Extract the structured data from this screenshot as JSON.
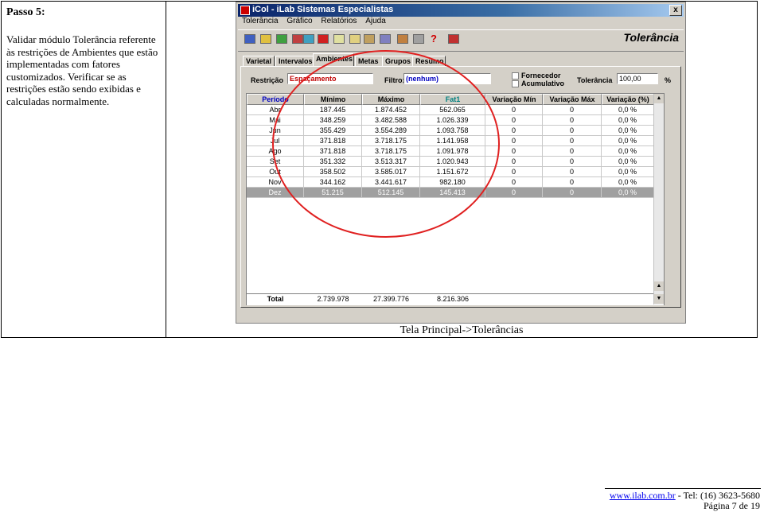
{
  "doc": {
    "step_title": "Passo 5:",
    "description": "Validar módulo Tolerância referente às restrições de Ambientes que estão implementadas com fatores customizados. Verificar se as restrições estão sendo exibidas e calculadas normalmente.",
    "caption": "Tela Principal->Tolerâncias"
  },
  "window": {
    "title": "iCol - iLab Sistemas Especialistas",
    "close": "x",
    "menu": [
      "Tolerância",
      "Gráfico",
      "Relatórios",
      "Ajuda"
    ],
    "header": "Tolerância",
    "tabs": [
      "Varietal",
      "Intervalos",
      "Ambientes",
      "Metas",
      "Grupos",
      "Resumo"
    ],
    "active_tab": "Ambientes"
  },
  "filters": {
    "restricao_label": "Restrição",
    "restricao_value": "Espaçamento",
    "filtro_label": "Filtro:",
    "filtro_value": "(nenhum)",
    "fornecedor_label": "Fornecedor",
    "acumulativo_label": "Acumulativo",
    "tolerancia_label": "Tolerância",
    "tolerancia_value": "100,00",
    "percent": "%"
  },
  "grid": {
    "columns": [
      "Período",
      "Mínimo",
      "Máximo",
      "Fat1",
      "Variação Mín",
      "Variação Máx",
      "Variação (%)"
    ],
    "rows": [
      [
        "Abr",
        "187.445",
        "1.874.452",
        "562.065",
        "0",
        "0",
        "0,0 %"
      ],
      [
        "Mai",
        "348.259",
        "3.482.588",
        "1.026.339",
        "0",
        "0",
        "0,0 %"
      ],
      [
        "Jun",
        "355.429",
        "3.554.289",
        "1.093.758",
        "0",
        "0",
        "0,0 %"
      ],
      [
        "Jul",
        "371.818",
        "3.718.175",
        "1.141.958",
        "0",
        "0",
        "0,0 %"
      ],
      [
        "Ago",
        "371.818",
        "3.718.175",
        "1.091.978",
        "0",
        "0",
        "0,0 %"
      ],
      [
        "Set",
        "351.332",
        "3.513.317",
        "1.020.943",
        "0",
        "0",
        "0,0 %"
      ],
      [
        "Out",
        "358.502",
        "3.585.017",
        "1.151.672",
        "0",
        "0",
        "0,0 %"
      ],
      [
        "Nov",
        "344.162",
        "3.441.617",
        "982.180",
        "0",
        "0",
        "0,0 %"
      ],
      [
        "Dez",
        "51.215",
        "512.145",
        "145.413",
        "0",
        "0",
        "0,0 %"
      ]
    ],
    "total": [
      "Total",
      "2.739.978",
      "27.399.776",
      "8.216.306"
    ]
  },
  "footer": {
    "link": "www.ilab.com.br",
    "tel": " - Tel: (16) 3623-5680",
    "page": "Página 7 de 19"
  },
  "colors": {
    "highlight_circle": "#e02020",
    "titlebar": "#0a246a"
  },
  "icons": [
    "toolbar-icon-1",
    "toolbar-icon-2",
    "toolbar-icon-3",
    "toolbar-icon-4",
    "toolbar-icon-5",
    "toolbar-icon-6",
    "toolbar-icon-7",
    "toolbar-icon-8",
    "toolbar-icon-9",
    "toolbar-icon-10",
    "toolbar-icon-11",
    "toolbar-icon-12",
    "help-icon",
    "exit-icon"
  ]
}
